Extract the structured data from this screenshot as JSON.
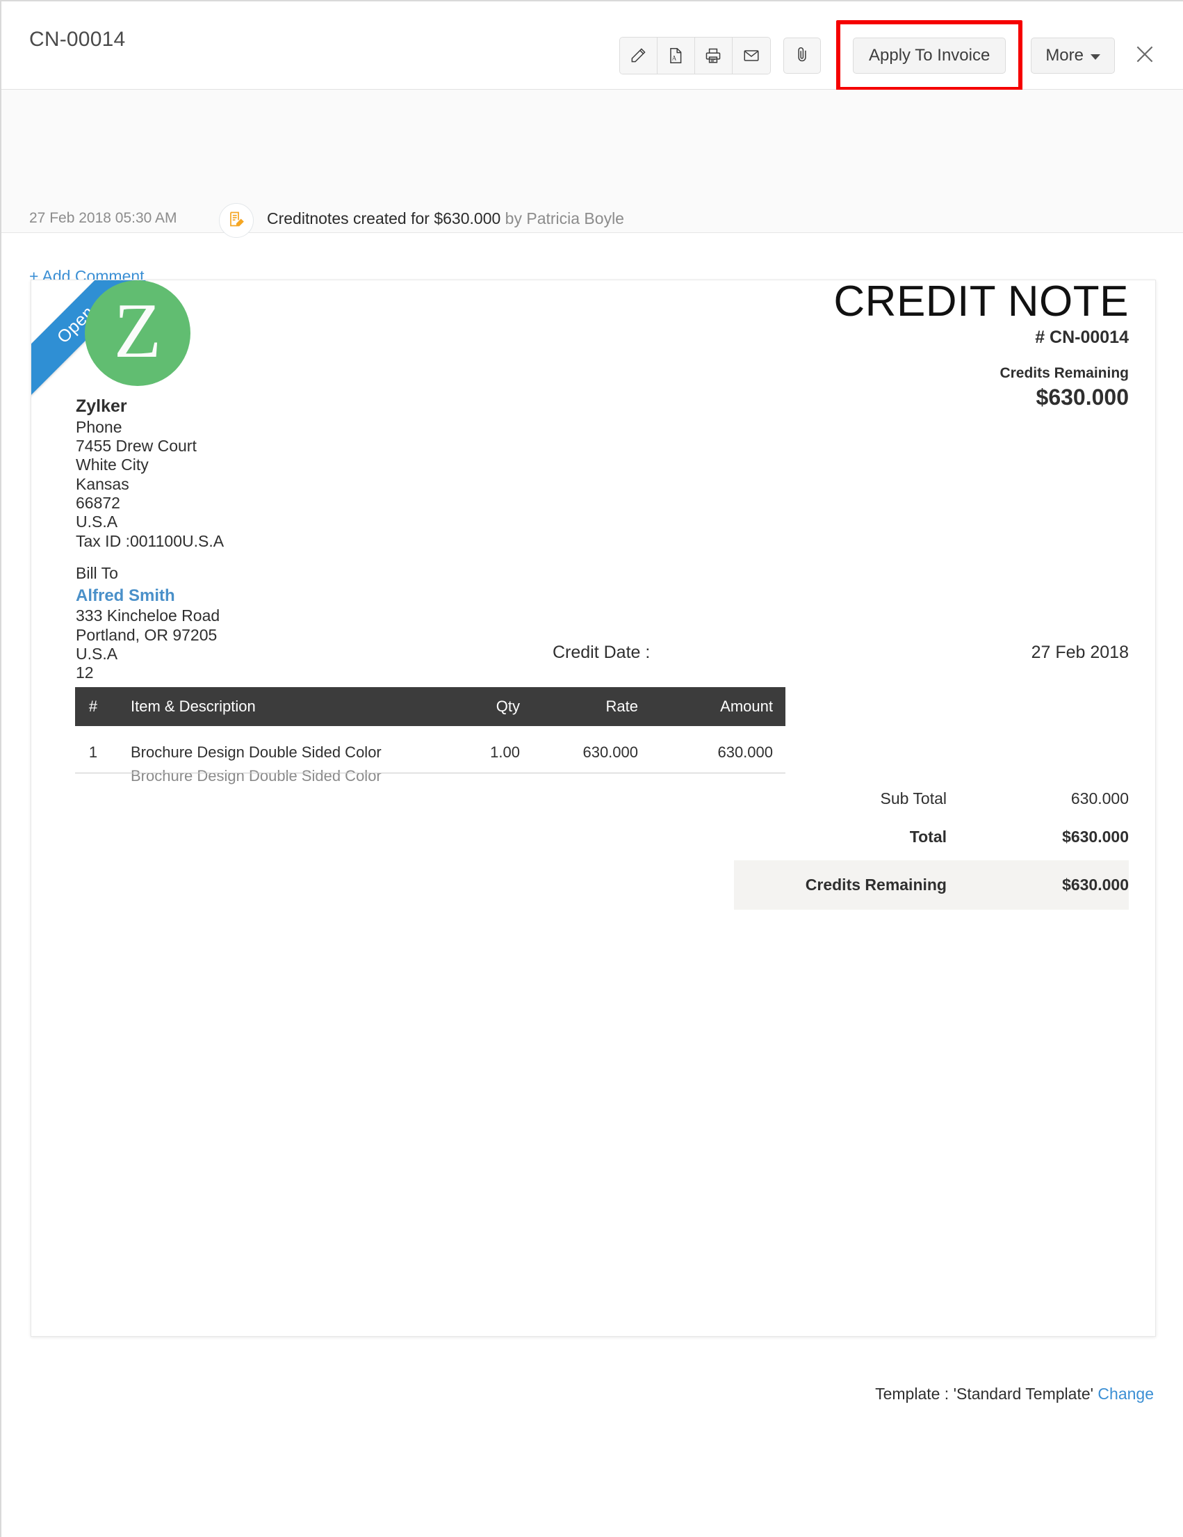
{
  "header": {
    "doc_id": "CN-00014",
    "toolbar": {
      "icons": [
        {
          "name": "edit-pencil-icon",
          "label": "Edit"
        },
        {
          "name": "pdf-file-icon",
          "label": "PDF"
        },
        {
          "name": "printer-icon",
          "label": "Print"
        },
        {
          "name": "envelope-icon",
          "label": "Email"
        }
      ],
      "attach_icon": "paperclip-icon",
      "apply_label": "Apply To Invoice",
      "more_label": "More",
      "close_icon": "close-icon"
    }
  },
  "activity": {
    "timestamp": "27 Feb 2018 05:30 AM",
    "icon": "note-edit-icon",
    "text": "Creditnotes created for $630.000",
    "by": "by Patricia Boyle",
    "add_comment_label": "+ Add Comment"
  },
  "document": {
    "ribbon_status": "Open",
    "logo_letter": "Z",
    "title": "CREDIT NOTE",
    "number": "# CN-00014",
    "credits_remaining_label": "Credits Remaining",
    "credits_remaining_value": "$630.000",
    "company": {
      "name": "Zylker",
      "lines": [
        "Phone",
        "7455 Drew Court",
        "White City",
        "Kansas",
        "66872",
        "U.S.A",
        "Tax ID :001100U.S.A"
      ]
    },
    "bill_to_label": "Bill To",
    "bill_to": {
      "customer": "Alfred Smith",
      "lines": [
        "333 Kincheloe Road",
        "Portland, OR 97205",
        "U.S.A",
        "12"
      ]
    },
    "credit_date_label": "Credit Date :",
    "credit_date_value": "27 Feb 2018",
    "table": {
      "columns": [
        "#",
        "Item & Description",
        "Qty",
        "Rate",
        "Amount"
      ],
      "rows": [
        {
          "num": "1",
          "item": "Brochure Design Double Sided Color",
          "description": "Brochure Design Double Sided Color",
          "qty": "1.00",
          "rate": "630.000",
          "amount": "630.000"
        }
      ]
    },
    "totals": [
      {
        "label": "Sub Total",
        "value": "630.000"
      },
      {
        "label": "Total",
        "value": "$630.000"
      },
      {
        "label": "Credits Remaining",
        "value": "$630.000"
      }
    ]
  },
  "footer": {
    "template_text": "Template : 'Standard Template'",
    "change_label": "Change"
  },
  "colors": {
    "accent_blue": "#3b8fd4",
    "ribbon_blue": "#2f8fd4",
    "logo_green": "#61bd71",
    "table_header": "#3c3c3c",
    "highlight_red": "#f50000",
    "note_orange": "#f5a623"
  }
}
